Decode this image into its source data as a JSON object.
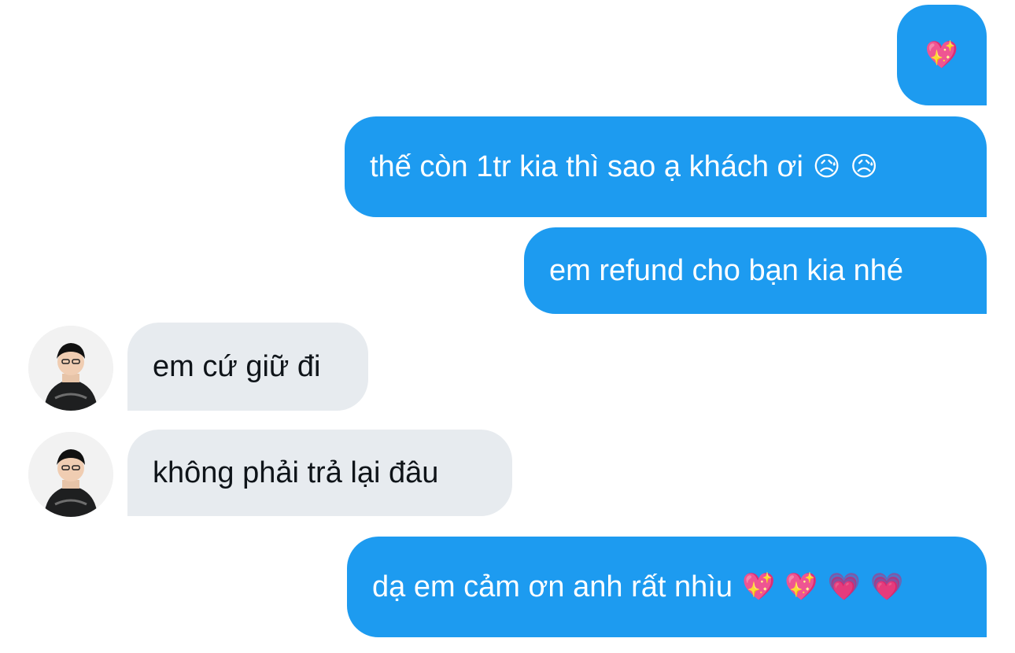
{
  "conversation": {
    "messages": [
      {
        "sender": "me",
        "text": "",
        "emojis": [
          "💖"
        ]
      },
      {
        "sender": "me",
        "text": "thế còn 1tr kia thì sao ạ khách ơi",
        "emojis": [
          "😥",
          "😥"
        ]
      },
      {
        "sender": "me",
        "text": "em refund cho bạn kia nhé",
        "emojis": []
      },
      {
        "sender": "other",
        "text": "em cứ giữ đi",
        "emojis": []
      },
      {
        "sender": "other",
        "text": "không phải trả lại đâu",
        "emojis": []
      },
      {
        "sender": "me",
        "text": "dạ em cảm ơn anh rất nhìu",
        "emojis": [
          "💖",
          "💖",
          "💗",
          "💗"
        ]
      }
    ]
  },
  "colors": {
    "sent_bubble": "#1d9bf0",
    "received_bubble": "#e7ebef",
    "sent_text": "#ffffff",
    "received_text": "#0f1419"
  },
  "icons": {
    "avatar": "user-photo-avatar"
  }
}
